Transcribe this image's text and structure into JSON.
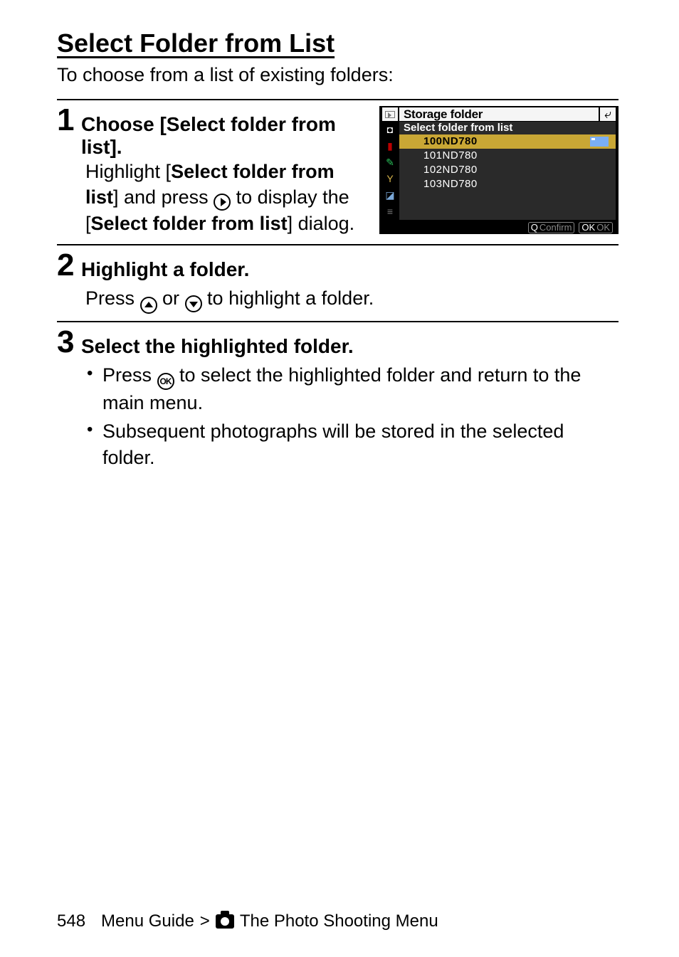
{
  "heading": "Select Folder from List",
  "intro": "To choose from a list of existing folders:",
  "steps": [
    {
      "num": "1",
      "title": "Choose [Select folder from list].",
      "body_parts": {
        "t1": "Highlight [",
        "b1": "Select folder from list",
        "t2": "] and press ",
        "t3": " to display the [",
        "b2": "Select folder from list",
        "t4": "] dialog."
      }
    },
    {
      "num": "2",
      "title": "Highlight a folder.",
      "body_parts": {
        "t1": "Press ",
        "t2": " or ",
        "t3": " to highlight a folder."
      }
    },
    {
      "num": "3",
      "title": "Select the highlighted folder.",
      "bullets": [
        {
          "pre": "Press ",
          "post": " to select the highlighted folder and return to the main menu."
        },
        {
          "text": "Subsequent photographs will be stored in the selected folder."
        }
      ]
    }
  ],
  "camera_ui": {
    "title": "Storage folder",
    "subtitle": "Select folder from list",
    "items": [
      "100ND780",
      "101ND780",
      "102ND780",
      "103ND780"
    ],
    "selected_index": 0,
    "footer_confirm_label": "Confirm",
    "footer_confirm_prefix": "Q",
    "footer_ok_prefix": "OK",
    "footer_ok_suffix": "OK"
  },
  "footer": {
    "page_number": "548",
    "crumb_left": "Menu Guide",
    "separator": ">",
    "crumb_right": "The Photo Shooting Menu"
  }
}
